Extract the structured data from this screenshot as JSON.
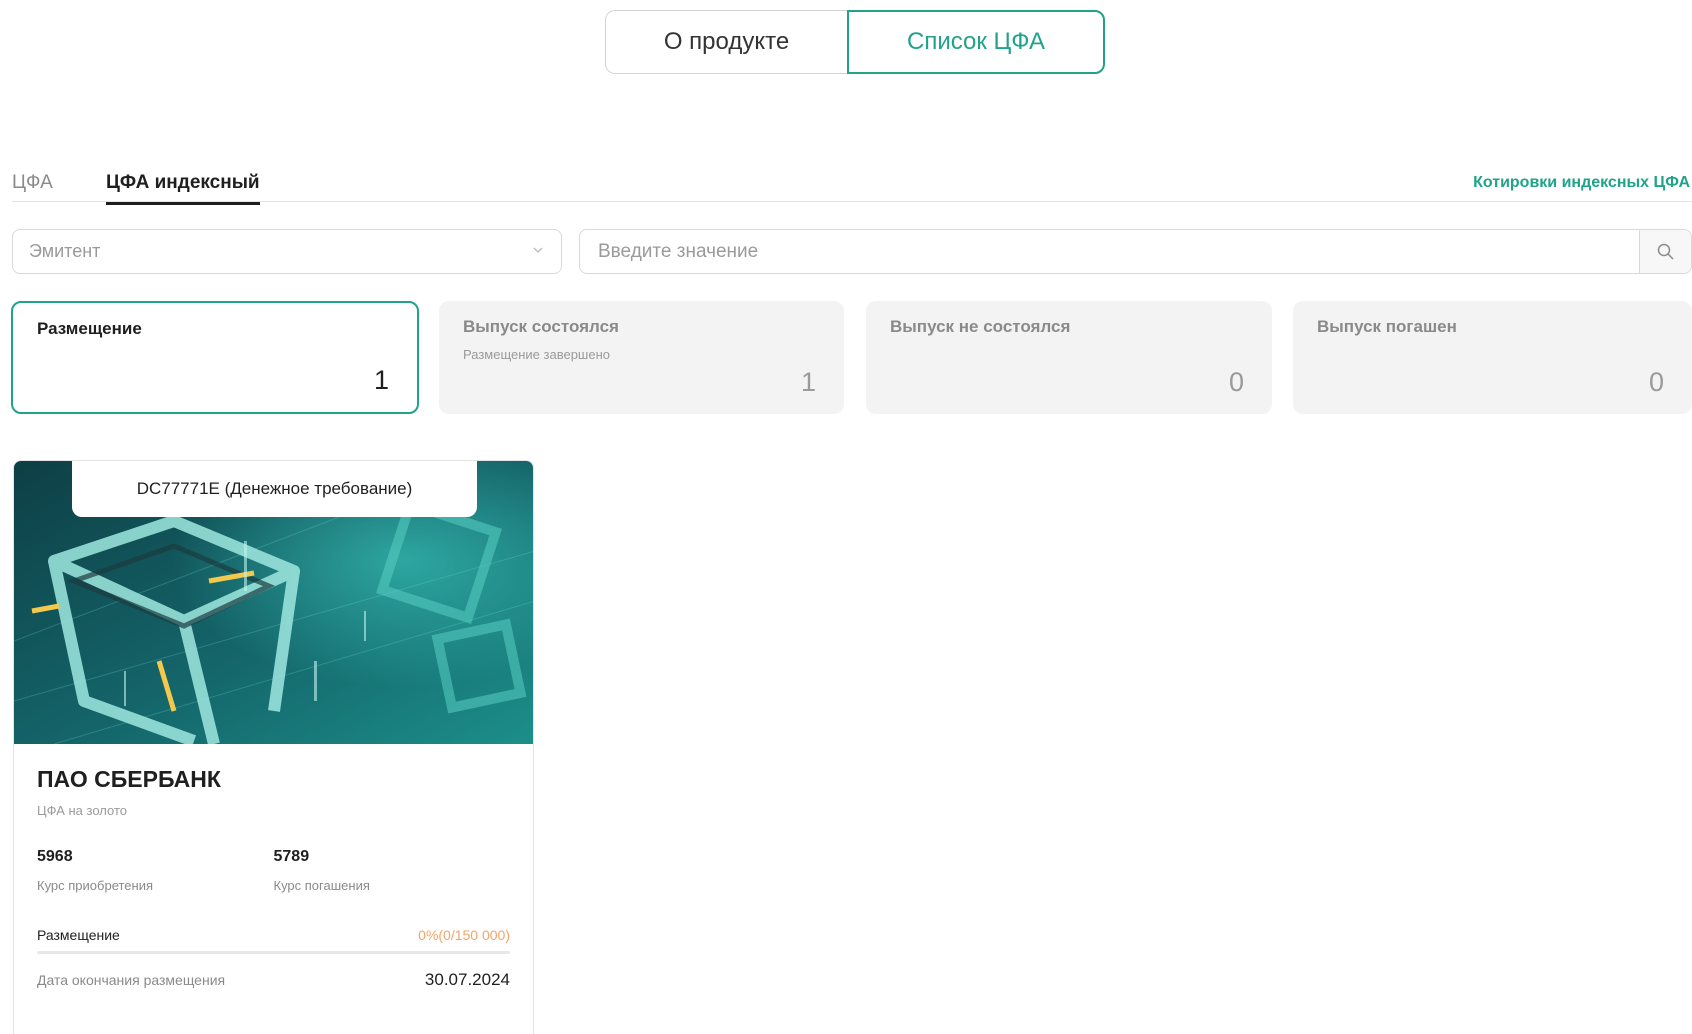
{
  "segment": {
    "about_label": "О продукте",
    "list_label": "Список ЦФА"
  },
  "tabs": [
    {
      "label": "ЦФА"
    },
    {
      "label": "ЦФА индексный"
    }
  ],
  "quotes_link": "Котировки индексных ЦФА",
  "filters": {
    "emitter_placeholder": "Эмитент",
    "search_placeholder": "Введите значение"
  },
  "statuses": [
    {
      "title": "Размещение",
      "subtitle": "",
      "count": "1",
      "active": true
    },
    {
      "title": "Выпуск состоялся",
      "subtitle": "Размещение завершено",
      "count": "1",
      "active": false
    },
    {
      "title": "Выпуск не состоялся",
      "subtitle": "",
      "count": "0",
      "active": false
    },
    {
      "title": "Выпуск погашен",
      "subtitle": "",
      "count": "0",
      "active": false
    }
  ],
  "card": {
    "tag": "DC77771E (Денежное требование)",
    "issuer": "ПАО СБЕРБАНК",
    "asset_type": "ЦФА на золото",
    "purchase_rate": "5968",
    "purchase_rate_label": "Курс приобретения",
    "redemption_rate": "5789",
    "redemption_rate_label": "Курс погашения",
    "placement_label": "Размещение",
    "placement_progress": "0%(0/150 000)",
    "placement_fraction": 0,
    "end_date_label": "Дата окончания размещения",
    "end_date": "30.07.2024"
  },
  "colors": {
    "accent": "#21a38a",
    "progress_text": "#f3a56b",
    "inactive_bg": "#f3f3f3"
  },
  "icons": {
    "emitter_dropdown": "chevron-down-icon",
    "search_button": "search-icon"
  }
}
